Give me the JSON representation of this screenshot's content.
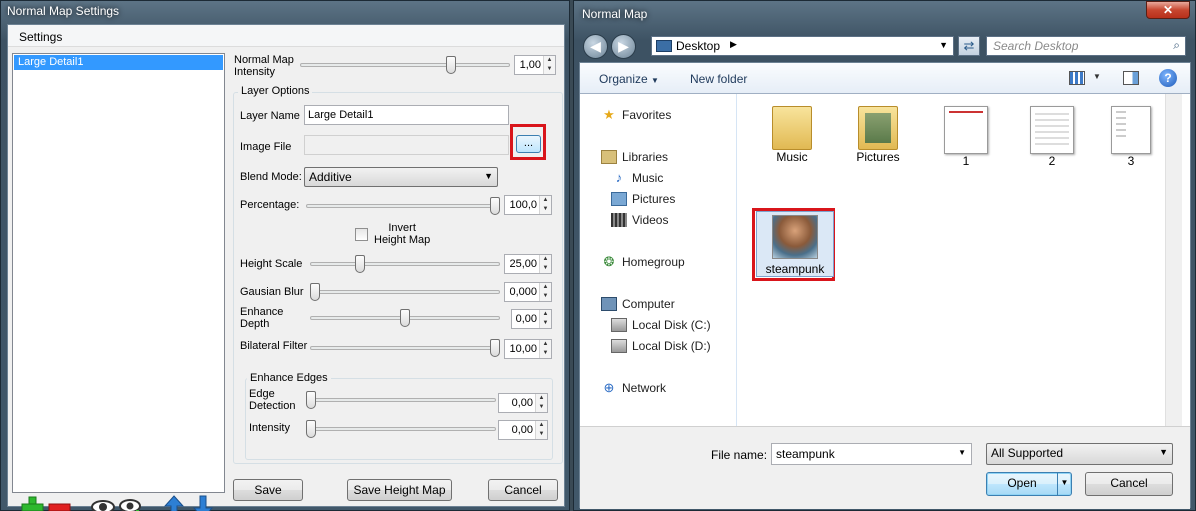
{
  "left_window": {
    "title": "Normal Map Settings",
    "menu": {
      "settings": "Settings"
    },
    "layers": [
      "Large Detail1"
    ],
    "intensity": {
      "label_line1": "Normal Map",
      "label_line2": "Intensity",
      "value": "1,00",
      "slider_fraction": 0.73
    },
    "layer_options": {
      "title": "Layer Options",
      "layer_name_label": "Layer Name",
      "layer_name_value": "Large Detail1",
      "image_file_label": "Image File",
      "image_file_value": "",
      "browse_label": "...",
      "blend_mode_label": "Blend Mode:",
      "blend_mode_value": "Additive",
      "percentage": {
        "label": "Percentage:",
        "value": "100,0",
        "slider_fraction": 1.0
      },
      "invert": {
        "line1": "Invert",
        "line2": "Height Map",
        "checked": false
      },
      "height_scale": {
        "label": "Height Scale",
        "value": "25,00",
        "slider_fraction": 0.25
      },
      "gausian_blur": {
        "label": "Gausian Blur",
        "value": "0,000",
        "slider_fraction": 0.0
      },
      "enhance_depth": {
        "line1": "Enhance",
        "line2": "Depth",
        "value": "0,00",
        "slider_fraction": 0.5
      },
      "bilateral_filter": {
        "label": "Bilateral Filter",
        "value": "10,00",
        "slider_fraction": 1.0
      },
      "enhance_edges": {
        "title": "Enhance Edges",
        "edge_detection": {
          "line1": "Edge",
          "line2": "Detection",
          "value": "0,00",
          "slider_fraction": 0.0
        },
        "intensity": {
          "label": "Intensity",
          "value": "0,00",
          "slider_fraction": 0.0
        }
      }
    },
    "buttons": {
      "save": "Save",
      "save_height_map": "Save Height Map",
      "cancel": "Cancel"
    },
    "toolbar_icons": [
      "add-icon",
      "remove-icon",
      "eye-icon",
      "eye-add-icon",
      "arrow-up-icon",
      "arrow-down-icon"
    ]
  },
  "right_window": {
    "title": "Normal Map",
    "address": "Desktop",
    "search_placeholder": "Search Desktop",
    "commands": {
      "organize": "Organize",
      "new_folder": "New folder"
    },
    "nav": {
      "favorites": "Favorites",
      "libraries": "Libraries",
      "music": "Music",
      "pictures": "Pictures",
      "videos": "Videos",
      "homegroup": "Homegroup",
      "computer": "Computer",
      "local_c": "Local Disk (C:)",
      "local_d": "Local Disk (D:)",
      "network": "Network"
    },
    "files": [
      "Music",
      "Pictures",
      "1",
      "2",
      "3",
      "steampunk"
    ],
    "file_name_label": "File name:",
    "file_name_value": "steampunk",
    "file_type": "All Supported",
    "buttons": {
      "open": "Open",
      "cancel": "Cancel"
    }
  },
  "colors": {
    "highlight_red": "#d9151b",
    "selection_blue": "#3399ff",
    "add_green": "#2eb82e",
    "remove_red": "#e02020",
    "arrow_blue": "#2d7fd4"
  }
}
